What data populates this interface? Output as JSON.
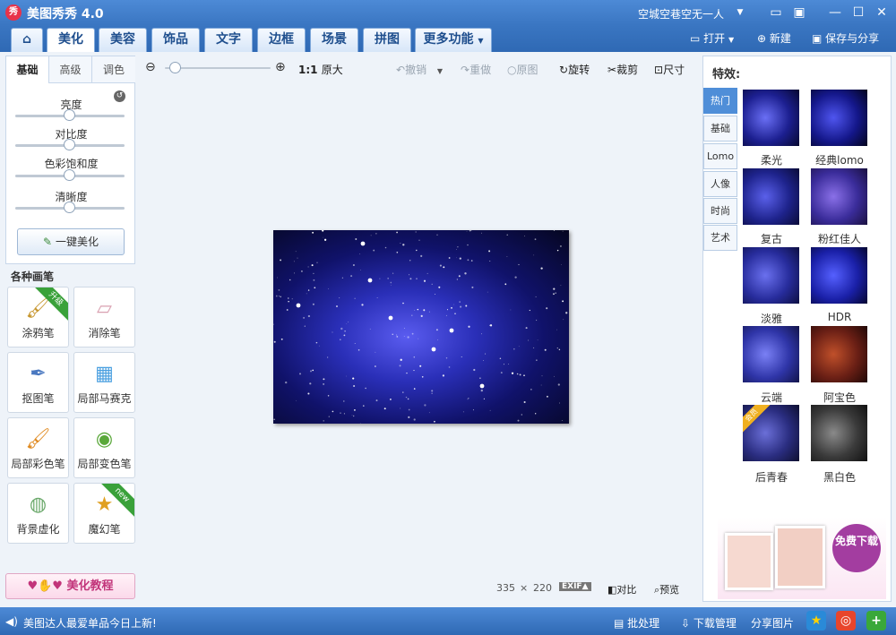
{
  "app": {
    "title": "美图秀秀 4.0",
    "logo": "秀",
    "user": "空城空巷空无一人"
  },
  "tabs": [
    "美化",
    "美容",
    "饰品",
    "文字",
    "边框",
    "场景",
    "拼图",
    "更多功能"
  ],
  "toolbar_right": {
    "open": "打开",
    "new": "新建",
    "save": "保存与分享"
  },
  "subtabs": [
    "基础",
    "高级",
    "调色"
  ],
  "sliders": [
    {
      "label": "亮度",
      "value": 0.5
    },
    {
      "label": "对比度",
      "value": 0.5
    },
    {
      "label": "色彩饱和度",
      "value": 0.5
    },
    {
      "label": "清晰度",
      "value": 0.5
    }
  ],
  "one_key": "一键美化",
  "brushes_title": "各种画笔",
  "brushes": [
    {
      "label": "涂鸦笔",
      "icon": "paintbrush-icon",
      "badge": "升级"
    },
    {
      "label": "消除笔",
      "icon": "eraser-icon"
    },
    {
      "label": "抠图笔",
      "icon": "pen-cutout-icon"
    },
    {
      "label": "局部马赛克",
      "icon": "mosaic-icon"
    },
    {
      "label": "局部彩色笔",
      "icon": "color-brush-icon"
    },
    {
      "label": "局部变色笔",
      "icon": "paint-bucket-icon"
    },
    {
      "label": "背景虚化",
      "icon": "blur-icon"
    },
    {
      "label": "魔幻笔",
      "icon": "magic-pen-icon",
      "badge": "new"
    }
  ],
  "tutorial": "美化教程",
  "zoom": {
    "original": "原大",
    "level": 0.05
  },
  "edit": {
    "undo": "撤销",
    "redo": "重做",
    "original": "原图",
    "rotate": "旋转",
    "crop": "裁剪",
    "size": "尺寸"
  },
  "image_size": {
    "width": "335",
    "sep": "×",
    "height": "220"
  },
  "exif": "EXIF▲",
  "compare": "对比",
  "preview": "预览",
  "effects": {
    "title": "特效:",
    "categories": [
      "热门",
      "基础",
      "Lomo",
      "人像",
      "时尚",
      "艺术"
    ],
    "items": [
      "柔光",
      "经典lomo",
      "复古",
      "粉红佳人",
      "淡雅",
      "HDR",
      "云端",
      "阿宝色",
      "后青春",
      "黑白色"
    ]
  },
  "ad": {
    "button": "免费下载",
    "badge": "会员"
  },
  "status": {
    "news": "美图达人最爱单品今日上新!",
    "batch": "批处理",
    "download": "下载管理",
    "share": "分享图片"
  },
  "colors": {
    "brand": "#3a76c2",
    "accent": "#4f8ed8"
  }
}
